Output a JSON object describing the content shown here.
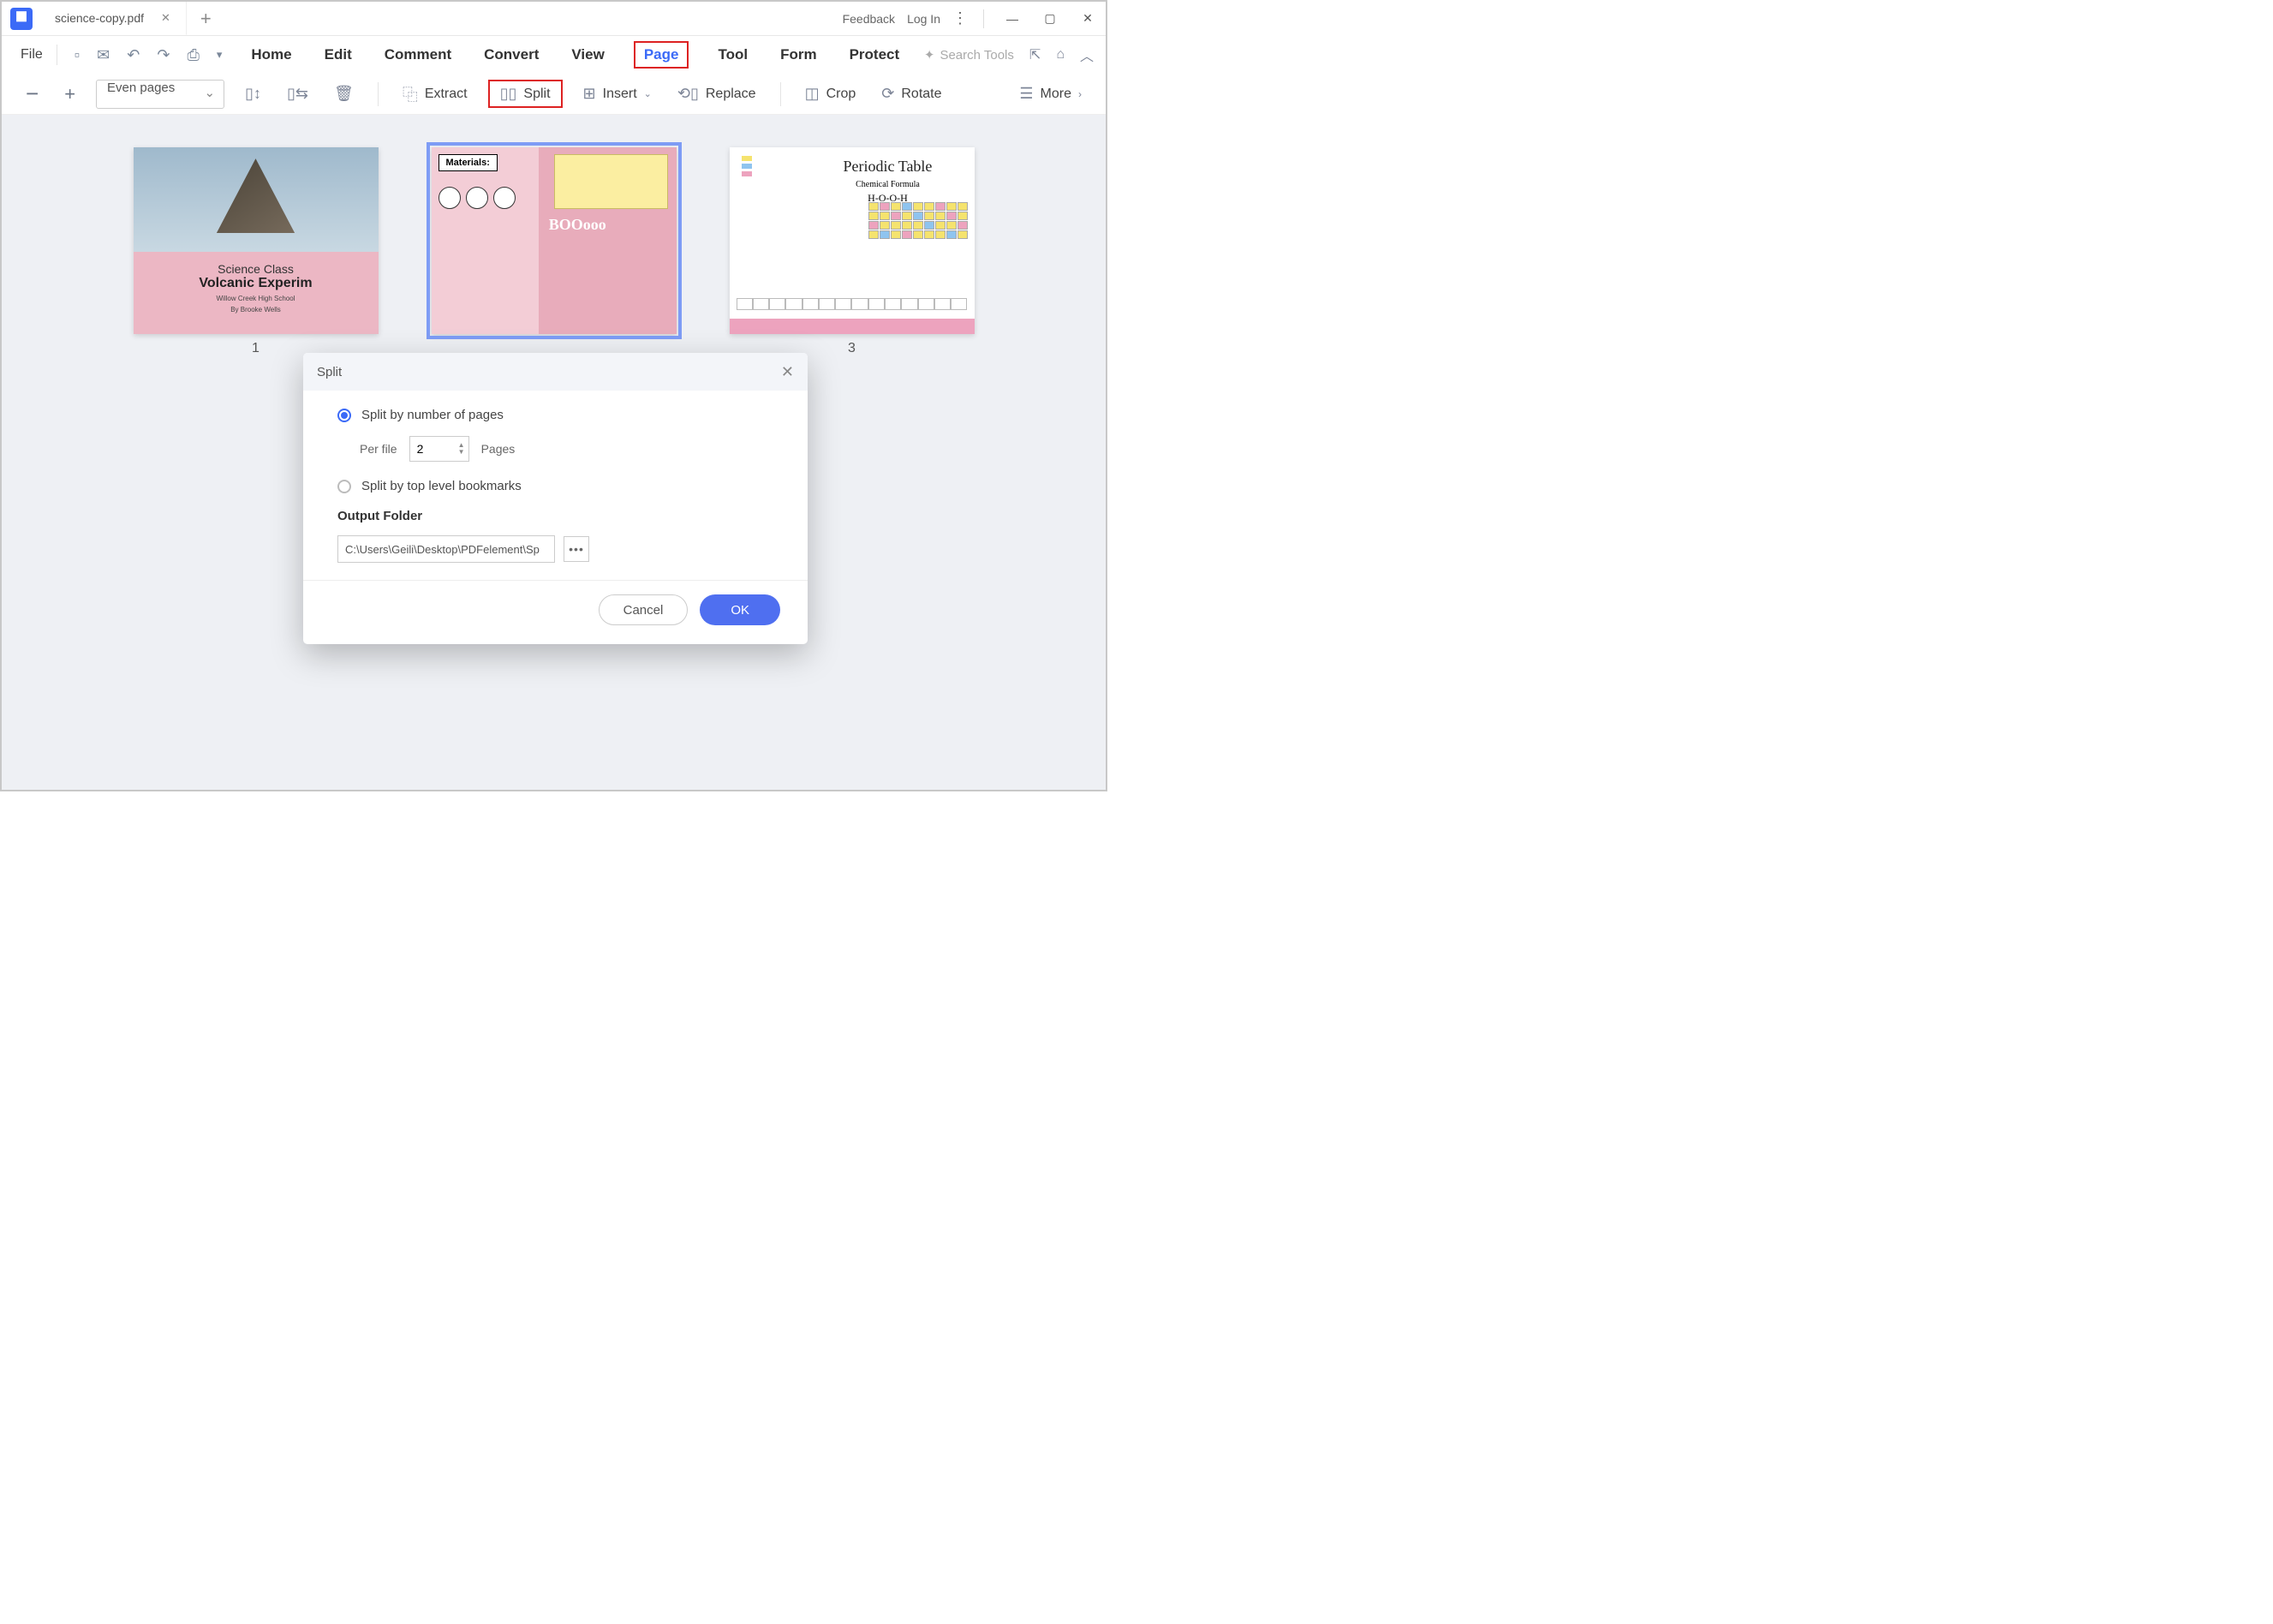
{
  "titlebar": {
    "tab_name": "science-copy.pdf",
    "feedback": "Feedback",
    "login": "Log In"
  },
  "menubar": {
    "file": "File",
    "tabs": [
      "Home",
      "Edit",
      "Comment",
      "Convert",
      "View",
      "Page",
      "Tool",
      "Form",
      "Protect"
    ],
    "active_tab": "Page",
    "search_placeholder": "Search Tools"
  },
  "toolbar": {
    "page_filter": "Even pages",
    "extract": "Extract",
    "split": "Split",
    "insert": "Insert",
    "replace": "Replace",
    "crop": "Crop",
    "rotate": "Rotate",
    "more": "More"
  },
  "pages": {
    "num1": "1",
    "num3": "3"
  },
  "thumb1": {
    "line1": "Science Class",
    "line2": "Volcanic Experim",
    "line3": "Willow Creek High School",
    "line4": "By Brooke Wells"
  },
  "thumb2": {
    "materials": "Materials:",
    "boom": "BOOooo"
  },
  "thumb3": {
    "title": "Periodic Table",
    "sub": "Chemical Formula",
    "formula": "H-O-O-H"
  },
  "dialog": {
    "title": "Split",
    "opt_pages": "Split by number of pages",
    "per_file": "Per file",
    "per_value": "2",
    "pages_label": "Pages",
    "opt_bookmarks": "Split by top level bookmarks",
    "output_label": "Output Folder",
    "output_path": "C:\\Users\\Geili\\Desktop\\PDFelement\\Sp",
    "cancel": "Cancel",
    "ok": "OK"
  }
}
